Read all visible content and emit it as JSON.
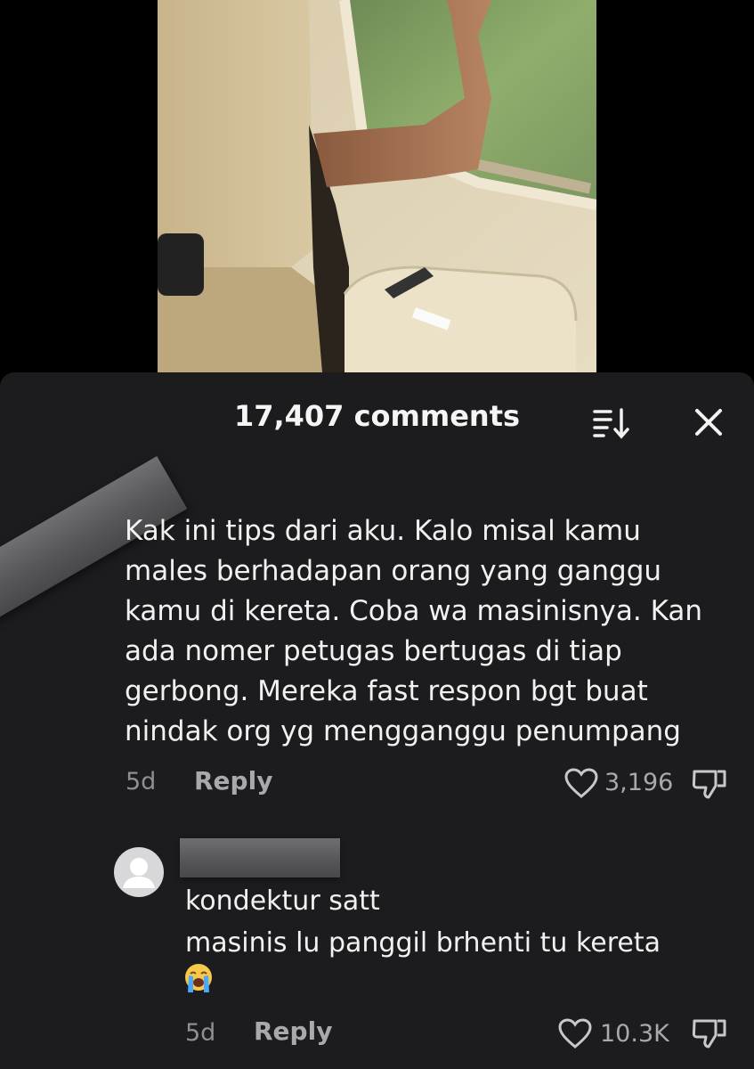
{
  "comments_sheet": {
    "title": "17,407 comments",
    "sort_icon": "sort-icon",
    "close_icon": "close-icon"
  },
  "comments": [
    {
      "text": "Kak ini tips dari aku. Kalo misal kamu\nmales berhadapan orang yang ganggu\nkamu di kereta. Coba wa masinisnya. Kan\nada nomer petugas bertugas di tiap\ngerbong. Mereka fast respon bgt buat\nnindak org yg mengganggu penumpang",
      "time": "5d",
      "reply_label": "Reply",
      "likes": "3,196"
    },
    {
      "text": "kondektur satt\nmasinis lu panggil brhenti tu kereta",
      "emoji": "loudly-crying-face",
      "time": "5d",
      "reply_label": "Reply",
      "likes": "10.3K"
    }
  ],
  "colors": {
    "sheet_bg": "#1c1c1e",
    "text": "#f1f1f1",
    "muted": "#8e8e93",
    "redaction": "#5a5a5c"
  }
}
